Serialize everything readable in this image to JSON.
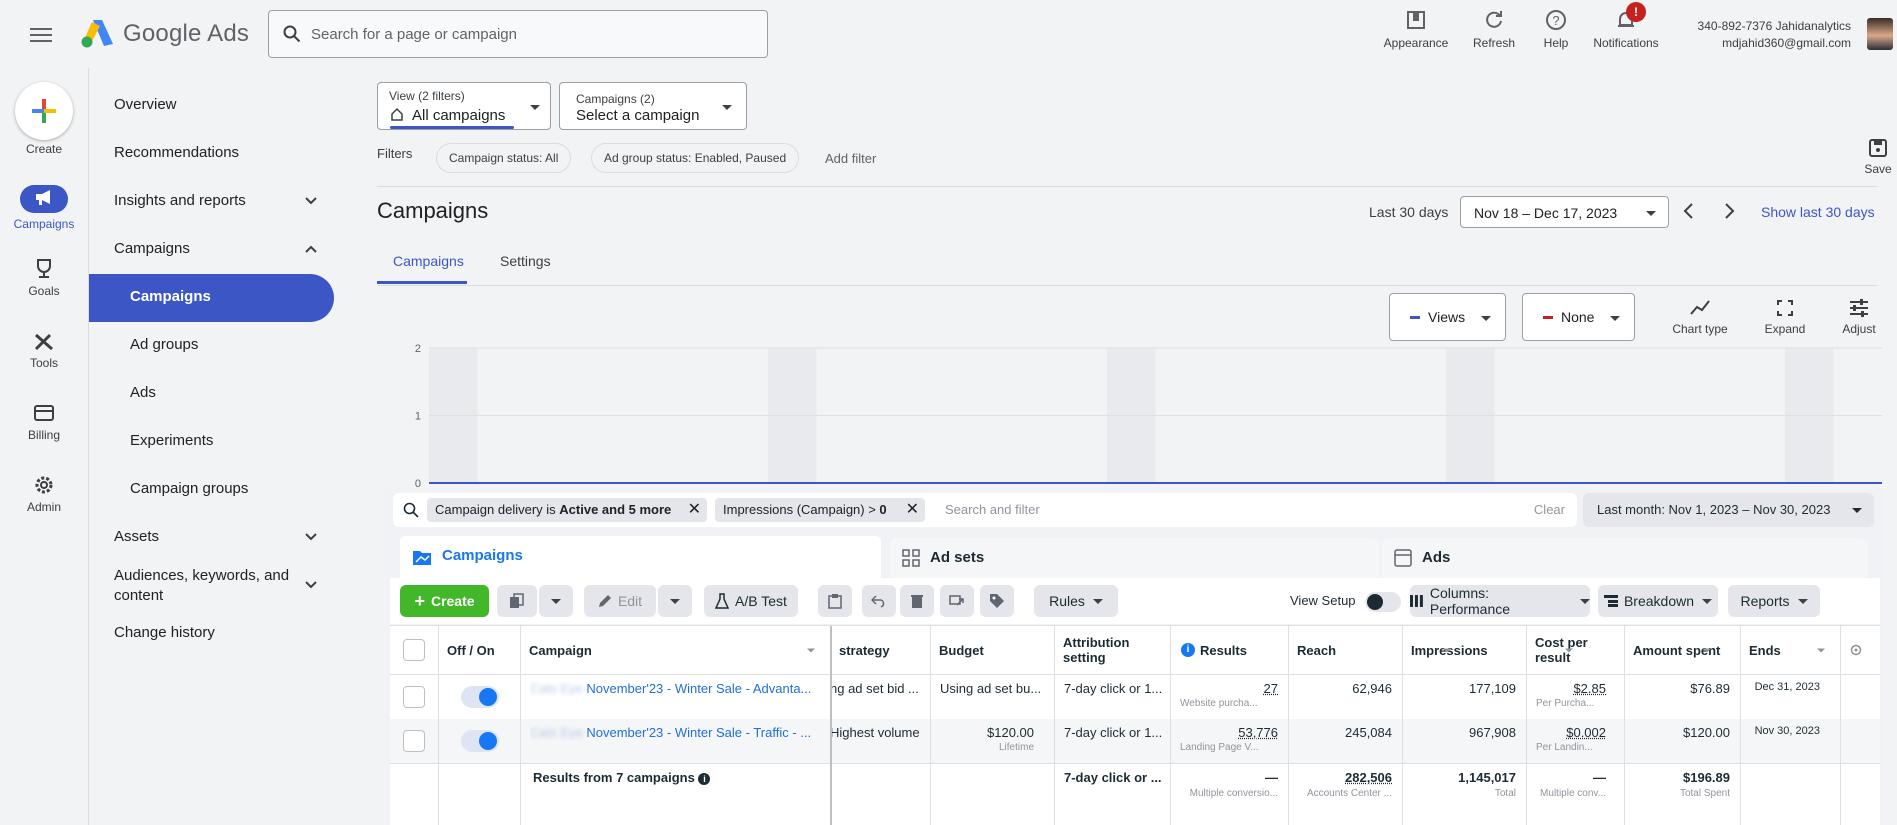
{
  "header": {
    "brand": "Google Ads",
    "search_placeholder": "Search for a page or campaign",
    "buttons": [
      {
        "label": "Appearance"
      },
      {
        "label": "Refresh"
      },
      {
        "label": "Help"
      },
      {
        "label": "Notifications"
      }
    ],
    "notif_badge": "!",
    "account_phone": "340-892-7376 Jahidanalytics",
    "account_email": "mdjahid360@gmail.com"
  },
  "rail": {
    "create": "Create",
    "campaigns": "Campaigns",
    "goals": "Goals",
    "tools": "Tools",
    "billing": "Billing",
    "admin": "Admin"
  },
  "nav": {
    "overview": "Overview",
    "recommendations": "Recommendations",
    "insights": "Insights and reports",
    "campaigns": "Campaigns",
    "campaigns_sub": "Campaigns",
    "ad_groups": "Ad groups",
    "ads": "Ads",
    "experiments": "Experiments",
    "campaign_groups": "Campaign groups",
    "assets": "Assets",
    "audiences": "Audiences, keywords, and content",
    "change_history": "Change history"
  },
  "view": {
    "label": "View (2 filters)",
    "value": "All campaigns"
  },
  "campaigns_dd": {
    "label": "Campaigns (2)",
    "value": "Select a campaign"
  },
  "filters": {
    "label": "Filters",
    "chip1": "Campaign status: All",
    "chip2": "Ad group status: Enabled, Paused",
    "add": "Add filter"
  },
  "save": "Save",
  "page_title": "Campaigns",
  "date": {
    "label": "Last 30 days",
    "range": "Nov 18 – Dec 17, 2023",
    "show_last": "Show last 30 days"
  },
  "tabs": {
    "campaigns": "Campaigns",
    "settings": "Settings"
  },
  "chart_controls": {
    "metric1": "Views",
    "metric2": "None",
    "chart_type": "Chart type",
    "expand": "Expand",
    "adjust": "Adjust"
  },
  "chart_data": {
    "type": "line",
    "yticks": [
      "2",
      "1",
      "0"
    ],
    "ylim": [
      0,
      2
    ],
    "series": [
      {
        "values": [
          0,
          0,
          0,
          0,
          0,
          0,
          0,
          0,
          0,
          0,
          0,
          0,
          0,
          0,
          0,
          0,
          0,
          0,
          0,
          0,
          0,
          0,
          0,
          0,
          0,
          0,
          0,
          0,
          0,
          0
        ]
      }
    ],
    "color": "#3c57c5"
  },
  "fb": {
    "filter_chip1_pre": "Campaign delivery is ",
    "filter_chip1_bold": "Active and 5 more",
    "filter_chip2_pre": "Impressions (Campaign) > ",
    "filter_chip2_bold": "0",
    "search_placeholder": "Search and filter",
    "clear": "Clear",
    "date": "Last month: Nov 1, 2023 – Nov 30, 2023",
    "tab_campaigns": "Campaigns",
    "tab_adsets": "Ad sets",
    "tab_ads": "Ads",
    "toolbar": {
      "create": "Create",
      "edit": "Edit",
      "ab_test": "A/B Test",
      "rules": "Rules",
      "view_setup": "View Setup",
      "columns": "Columns: Performance",
      "breakdown": "Breakdown",
      "reports": "Reports"
    },
    "columns": [
      "Off / On",
      "Campaign",
      "strategy",
      "Budget",
      "Attribution setting",
      "Results",
      "Reach",
      "Impressions",
      "Cost per result",
      "Amount spent",
      "Ends"
    ],
    "rows": [
      {
        "prefix": "Cats Eye",
        "campaign": "November'23 - Winter Sale - Advanta...",
        "strategy": "ng ad set bid ...",
        "budget": "Using ad set bu...",
        "budget_sub": "",
        "attribution": "7-day click or 1...",
        "results": "27",
        "results_sub": "Website purcha...",
        "reach": "62,946",
        "impressions": "177,109",
        "cost": "$2.85",
        "cost_sub": "Per Purcha...",
        "spent": "$76.89",
        "ends": "Dec 31, 2023"
      },
      {
        "prefix": "Cats Eye",
        "campaign": "November'23 - Winter Sale - Traffic - ...",
        "strategy": "Highest volume",
        "budget": "$120.00",
        "budget_sub": "Lifetime",
        "attribution": "7-day click or 1...",
        "results": "53,776",
        "results_sub": "Landing Page V...",
        "reach": "245,084",
        "impressions": "967,908",
        "cost": "$0.002",
        "cost_sub": "Per Landin...",
        "spent": "$120.00",
        "ends": "Nov 30, 2023"
      }
    ],
    "summary": {
      "label": "Results from 7 campaigns",
      "attribution": "7-day click or ...",
      "results": "—",
      "results_sub": "Multiple conversio...",
      "reach": "282,506",
      "reach_sub": "Accounts Center ...",
      "impressions": "1,145,017",
      "impressions_sub": "Total",
      "cost": "—",
      "cost_sub": "Multiple conv...",
      "spent": "$196.89",
      "spent_sub": "Total Spent"
    }
  }
}
